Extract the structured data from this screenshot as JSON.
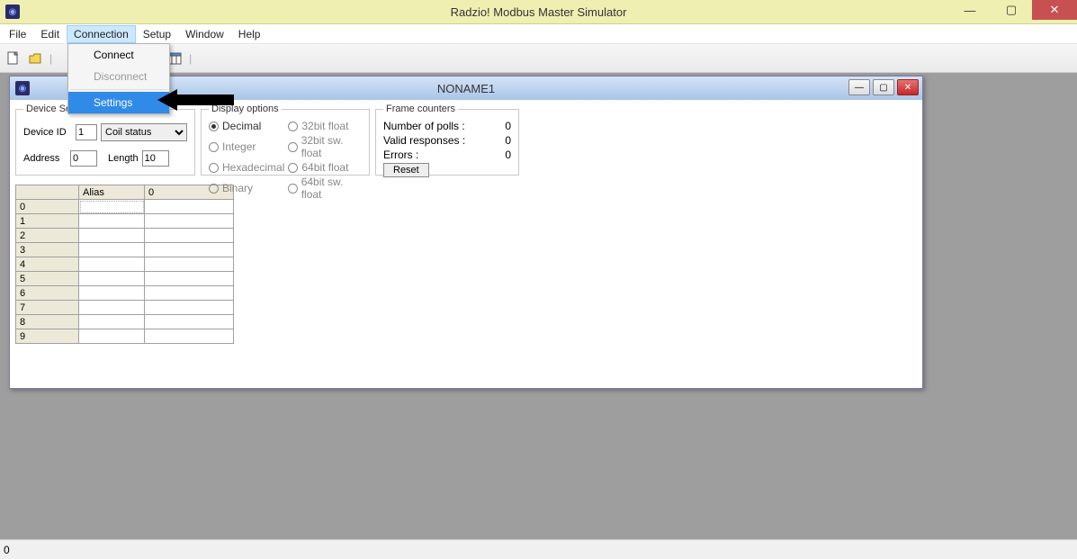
{
  "app": {
    "title": "Radzio! Modbus Master Simulator"
  },
  "menu": {
    "file": "File",
    "edit": "Edit",
    "connection": "Connection",
    "setup": "Setup",
    "window": "Window",
    "help": "Help"
  },
  "dropdown": {
    "connect": "Connect",
    "disconnect": "Disconnect",
    "settings": "Settings"
  },
  "child": {
    "title": "NONAME1"
  },
  "device": {
    "legend": "Device Settings",
    "idLabel": "Device ID",
    "idValue": "1",
    "typeValue": "Coil status",
    "addrLabel": "Address",
    "addrValue": "0",
    "lenLabel": "Length",
    "lenValue": "10"
  },
  "display": {
    "legend": "Display options",
    "decimal": "Decimal",
    "integer": "Integer",
    "hex": "Hexadecimal",
    "binary": "Binary",
    "f32": "32bit float",
    "f32s": "32bit sw. float",
    "f64": "64bit float",
    "f64s": "64bit sw. float"
  },
  "frame": {
    "legend": "Frame counters",
    "pollsLabel": "Number of polls :",
    "pollsVal": "0",
    "validLabel": "Valid responses :",
    "validVal": "0",
    "errLabel": "Errors :",
    "errVal": "0",
    "reset": "Reset"
  },
  "table": {
    "aliasHeader": "Alias",
    "valHeader": "0",
    "rows": [
      "0",
      "1",
      "2",
      "3",
      "4",
      "5",
      "6",
      "7",
      "8",
      "9"
    ]
  },
  "status": {
    "text": "0"
  }
}
